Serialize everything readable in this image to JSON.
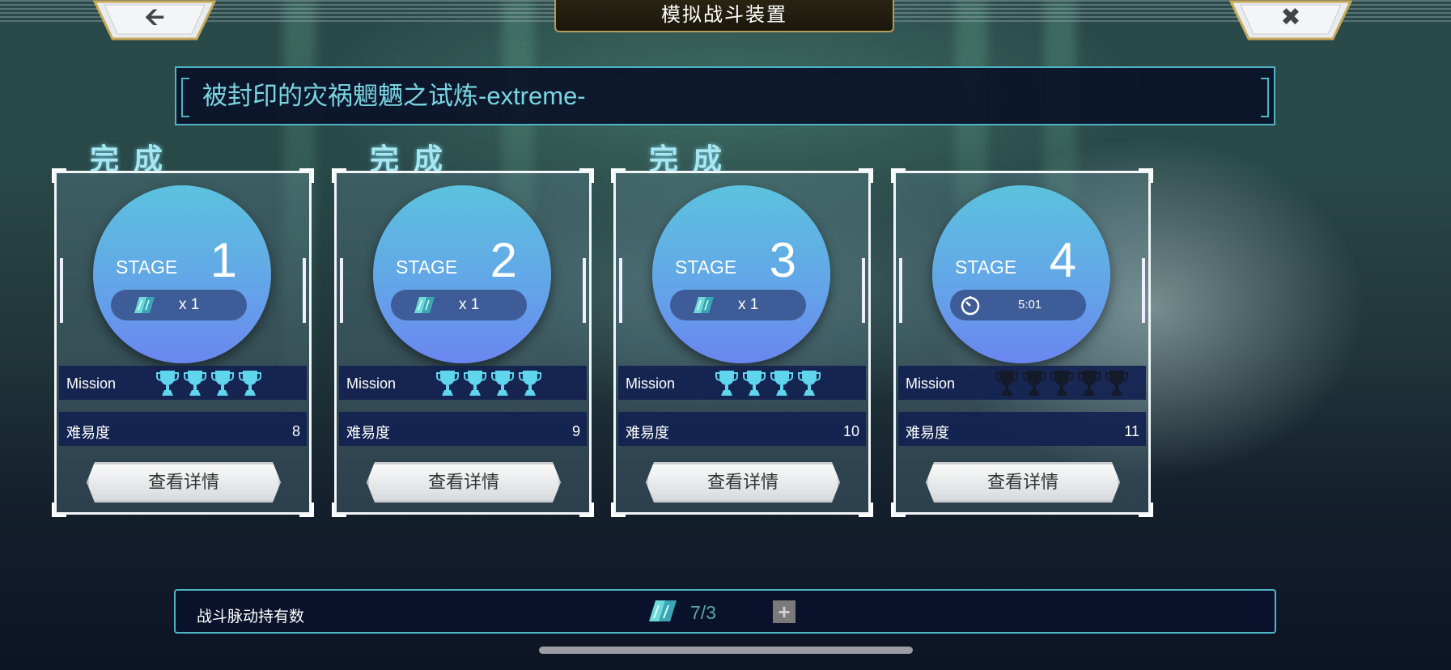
{
  "header": {
    "back_icon": "left-arrow-icon",
    "close_icon": "close-x-icon",
    "title": "模拟战斗装置"
  },
  "stage_name": "被封印的灾祸魍魉之试炼-extreme-",
  "completed_label": "完成",
  "stages": [
    {
      "stage_word": "STAGE",
      "number": "1",
      "cost": "x 1",
      "cost_icon": "battle-pulse-icon",
      "mission_label": "Mission",
      "trophies_earned": 4,
      "trophies_total": 4,
      "difficulty_label": "难易度",
      "difficulty": "8",
      "button": "查看详情",
      "completed": true
    },
    {
      "stage_word": "STAGE",
      "number": "2",
      "cost": "x 1",
      "cost_icon": "battle-pulse-icon",
      "mission_label": "Mission",
      "trophies_earned": 4,
      "trophies_total": 4,
      "difficulty_label": "难易度",
      "difficulty": "9",
      "button": "查看详情",
      "completed": true
    },
    {
      "stage_word": "STAGE",
      "number": "3",
      "cost": "x 1",
      "cost_icon": "battle-pulse-icon",
      "mission_label": "Mission",
      "trophies_earned": 4,
      "trophies_total": 4,
      "difficulty_label": "难易度",
      "difficulty": "10",
      "button": "查看详情",
      "completed": true
    },
    {
      "stage_word": "STAGE",
      "number": "4",
      "timer": "5:01",
      "timer_icon": "timer-icon",
      "mission_label": "Mission",
      "trophies_earned": 0,
      "trophies_total": 5,
      "difficulty_label": "难易度",
      "difficulty": "11",
      "button": "查看详情",
      "completed": false
    }
  ],
  "footer": {
    "label": "战斗脉动持有数",
    "icon": "battle-pulse-icon",
    "count": "7/3",
    "add_icon": "plus-icon"
  },
  "colors": {
    "trophy_active": "#5fd6ee",
    "trophy_inactive": "#141a2a",
    "accent": "#4fb4c4",
    "title_border": "#b39b5a"
  }
}
